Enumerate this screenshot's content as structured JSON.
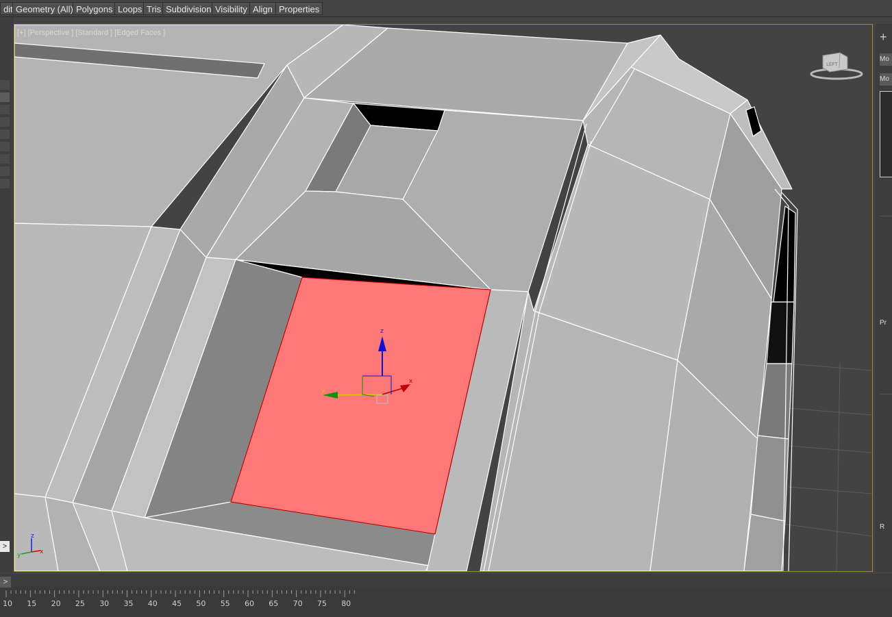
{
  "menubar": {
    "items": [
      "dit",
      "Geometry (All)",
      "Polygons",
      "Loops",
      "Tris",
      "Subdivision",
      "Visibility",
      "Align",
      "Properties"
    ]
  },
  "viewport": {
    "label": "[+] [Perspective ] [Standard ] [Edged Faces ]",
    "viewcube_face": "LEFT",
    "axis_x": "x",
    "axis_y": "y",
    "axis_z": "z",
    "selection_color": "#ff7878",
    "border_color": "#a08a3c"
  },
  "command_panel": {
    "create_icon": "+",
    "modify_label_1": "Mo",
    "modify_label_2": "Mo",
    "label_pr": "Pr",
    "label_r": "R"
  },
  "left_panel": {
    "arrow": ">"
  },
  "timeline": {
    "expand": ">",
    "ruler_ticks": [
      "10",
      "15",
      "20",
      "25",
      "30",
      "35",
      "40",
      "45",
      "50",
      "55",
      "60",
      "65",
      "70",
      "75",
      "80"
    ]
  }
}
